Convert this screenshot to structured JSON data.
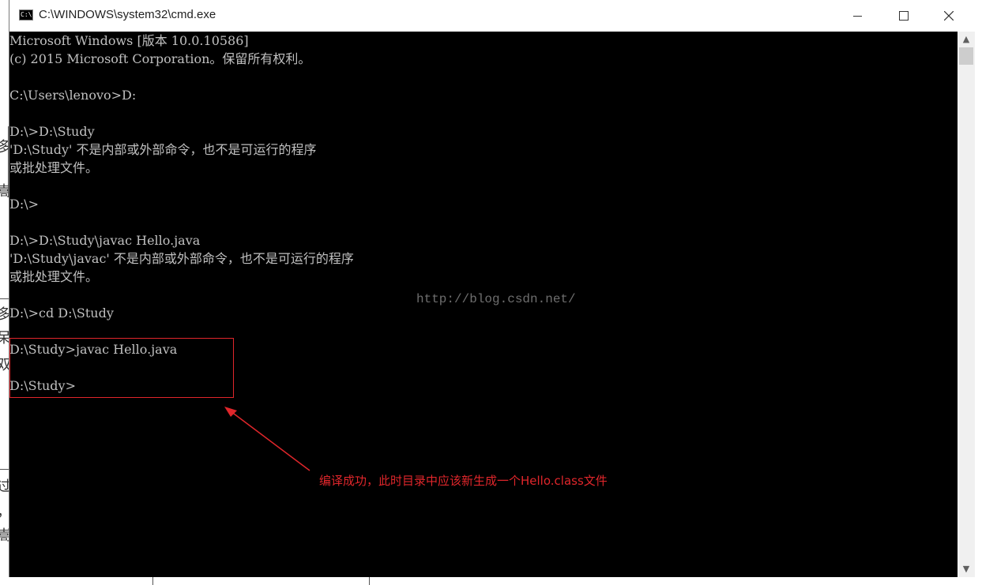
{
  "window": {
    "title": "C:\\WINDOWS\\system32\\cmd.exe",
    "icon": "cmd-icon",
    "icon_text": "C:\\."
  },
  "console": {
    "lines": [
      "Microsoft Windows [版本 10.0.10586]",
      "(c) 2015 Microsoft Corporation。保留所有权利。",
      "",
      "C:\\Users\\lenovo>D:",
      "",
      "D:\\>D:\\Study",
      "'D:\\Study' 不是内部或外部命令，也不是可运行的程序",
      "或批处理文件。",
      "",
      "D:\\>",
      "",
      "D:\\>D:\\Study\\javac Hello.java",
      "'D:\\Study\\javac' 不是内部或外部命令，也不是可运行的程序",
      "或批处理文件。",
      "",
      "D:\\>cd D:\\Study",
      "",
      "D:\\Study>javac Hello.java",
      "",
      "D:\\Study>"
    ]
  },
  "watermark": "http://blog.csdn.net/",
  "annotation": {
    "text": "编译成功，此时目录中应该新生成一个Hello.class文件",
    "color": "#e0262b"
  },
  "background_fragments": [
    "多",
    "嵩",
    "多",
    "呆",
    "双",
    "过",
    "，",
    "嵩"
  ],
  "colors": {
    "console_bg": "#000000",
    "console_text": "#c0c0c0",
    "annotation_red": "#e0262b"
  }
}
